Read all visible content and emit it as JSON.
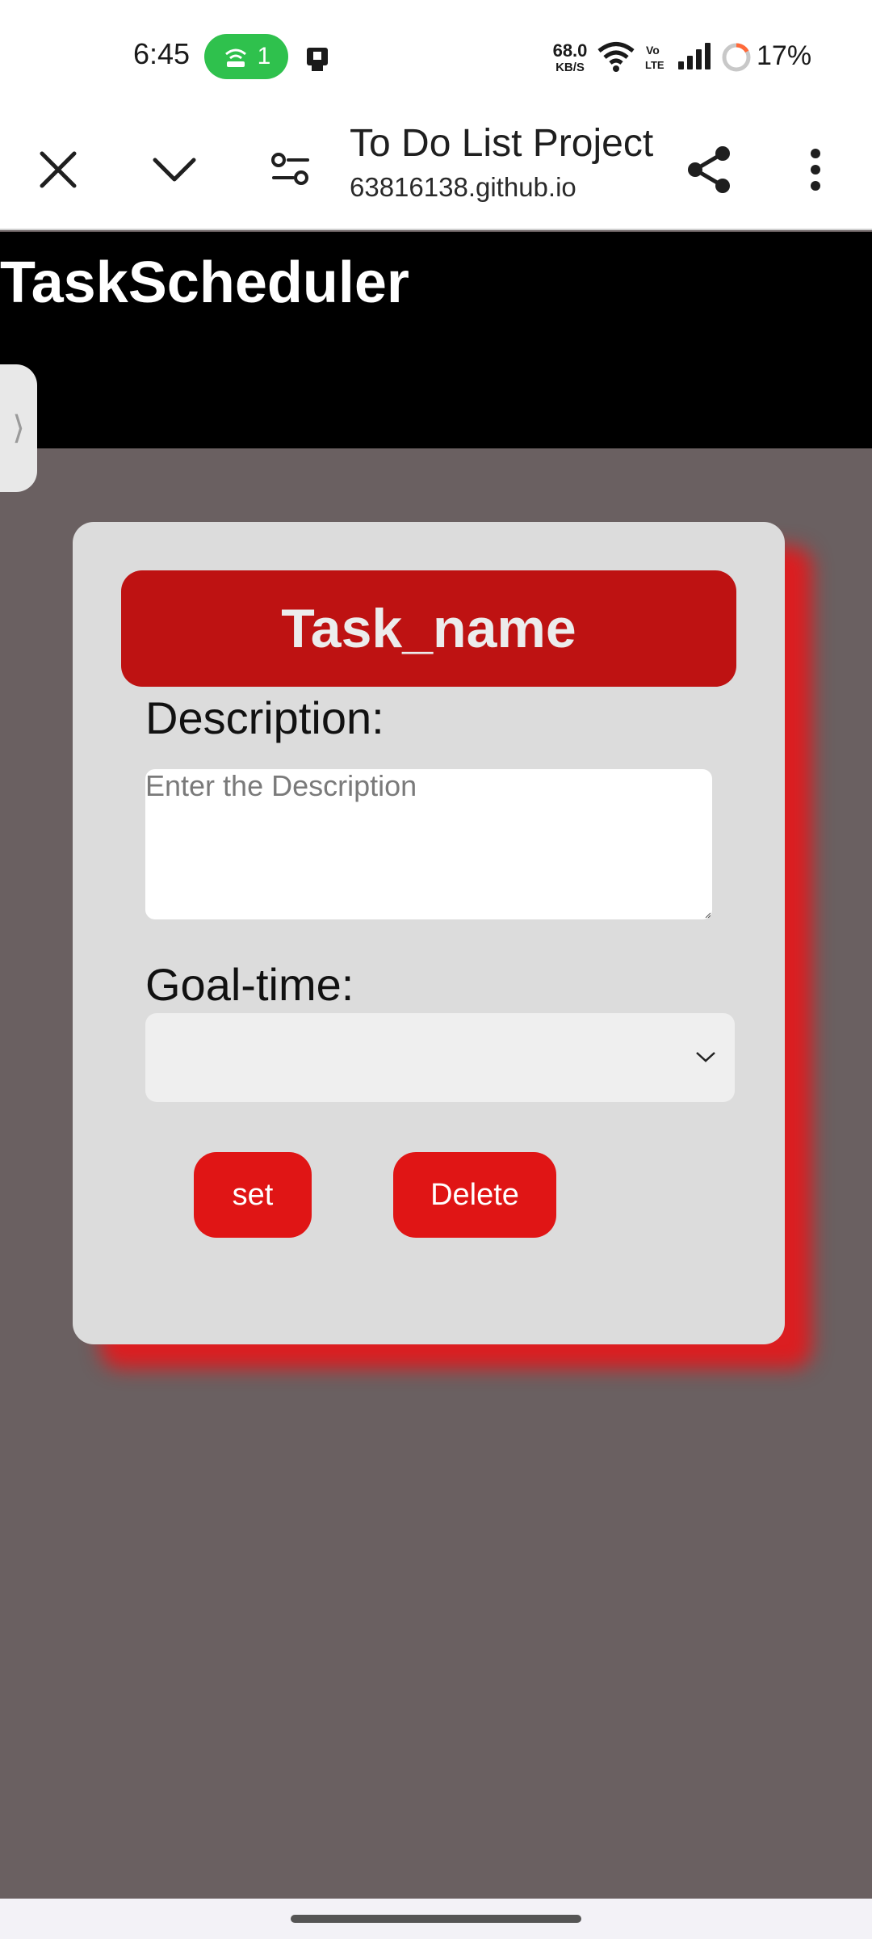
{
  "status_bar": {
    "time": "6:45",
    "hotspot_count": "1",
    "net_speed_value": "68.0",
    "net_speed_unit": "KB/S",
    "battery_percent": "17%",
    "battery_level_fraction": 0.17
  },
  "browser": {
    "page_title": "To Do List Project",
    "url": "63816138.github.io",
    "icons": [
      "close-icon",
      "chevron-down-icon",
      "page-settings-icon",
      "share-icon",
      "more-vert-icon"
    ]
  },
  "site": {
    "title": "TaskScheduler",
    "side_tab_glyph": "⟩"
  },
  "card": {
    "task_name": "Task_name",
    "description_label": "Description:",
    "description_placeholder": "Enter the Description",
    "description_value": "",
    "goal_time_label": "Goal-time:",
    "goal_time_value": "",
    "set_label": "set",
    "delete_label": "Delete"
  },
  "colors": {
    "header_bg": "#000000",
    "page_bg": "#6a6061",
    "card_bg": "#dcdcdc",
    "banner_red": "#be1212",
    "button_red": "#e01515",
    "shadow_red": "#e21a1e",
    "hotspot_green": "#2fc14d"
  }
}
